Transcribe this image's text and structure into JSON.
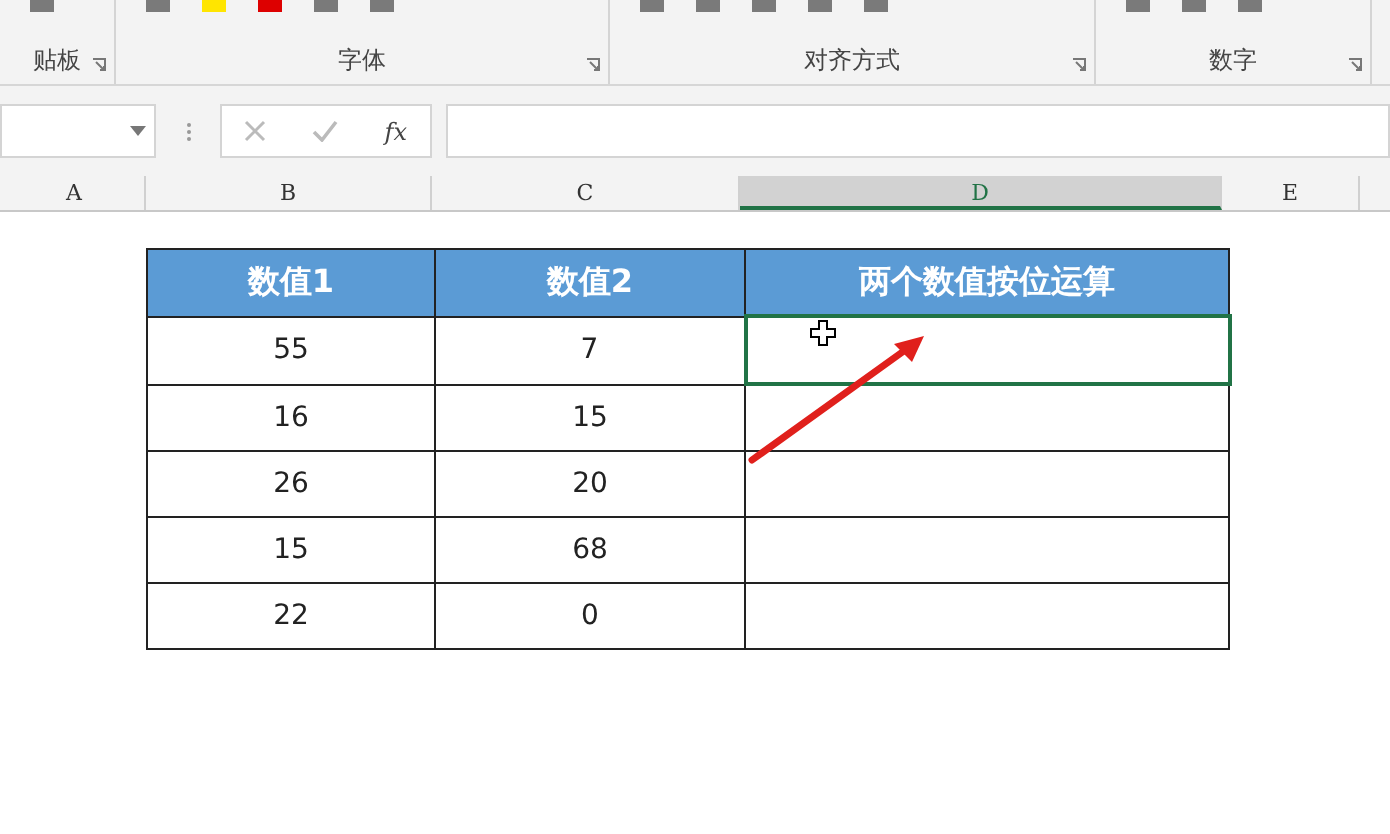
{
  "ribbon": {
    "groups": [
      {
        "label": "贴板"
      },
      {
        "label": "字体"
      },
      {
        "label": "对齐方式"
      },
      {
        "label": "数字"
      }
    ]
  },
  "formula_bar": {
    "fx_label": "fx"
  },
  "columns": [
    {
      "label": "A",
      "selected": false
    },
    {
      "label": "B",
      "selected": false
    },
    {
      "label": "C",
      "selected": false
    },
    {
      "label": "D",
      "selected": true
    },
    {
      "label": "E",
      "selected": false
    }
  ],
  "table": {
    "columns": [
      "数值1",
      "数值2",
      "两个数值按位运算"
    ],
    "rows": [
      {
        "cells": [
          "55",
          "7",
          ""
        ],
        "selected": true
      },
      {
        "cells": [
          "16",
          "15",
          ""
        ],
        "selected": false
      },
      {
        "cells": [
          "26",
          "20",
          ""
        ],
        "selected": false
      },
      {
        "cells": [
          "15",
          "68",
          ""
        ],
        "selected": false
      },
      {
        "cells": [
          "22",
          "0",
          ""
        ],
        "selected": false
      }
    ]
  }
}
